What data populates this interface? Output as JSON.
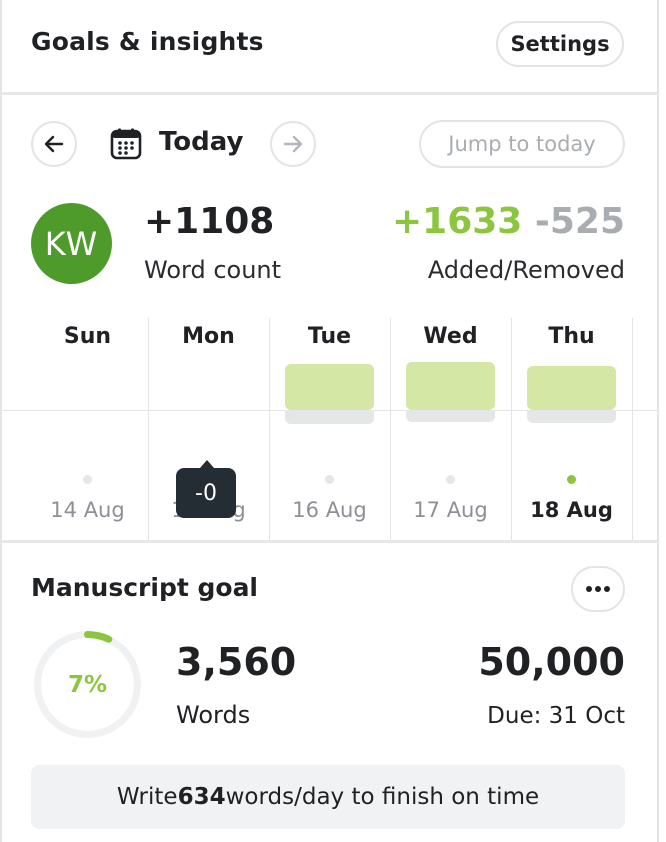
{
  "header": {
    "title": "Goals & insights",
    "settings_label": "Settings"
  },
  "date_nav": {
    "label": "Today",
    "jump_label": "Jump to today"
  },
  "stats": {
    "avatar_initials": "KW",
    "word_count_value": "+1108",
    "word_count_label": "Word count",
    "added": "+1633",
    "removed": "-525",
    "added_removed_label": "Added/Removed"
  },
  "week": {
    "days": [
      {
        "name": "Sun",
        "date": "14 Aug",
        "added": 0,
        "removed": 0,
        "today": false
      },
      {
        "name": "Mon",
        "date": "15 Aug",
        "added": 0,
        "removed": 0,
        "today": false
      },
      {
        "name": "Tue",
        "date": "16 Aug",
        "added": 1,
        "removed": 0.3,
        "today": false
      },
      {
        "name": "Wed",
        "date": "17 Aug",
        "added": 1.05,
        "removed": 0.25,
        "today": false
      },
      {
        "name": "Thu",
        "date": "18 Aug",
        "added": 0.95,
        "removed": 0.28,
        "today": true
      }
    ],
    "tooltip": "-0"
  },
  "manuscript": {
    "title": "Manuscript goal",
    "progress_percent": 7,
    "percent_label": "7%",
    "words_value": "3,560",
    "words_label": "Words",
    "goal_value": "50,000",
    "due_label": "Due: 31 Oct",
    "banner_prefix": "Write ",
    "banner_bold": "634",
    "banner_suffix": " words/day to finish on time"
  },
  "colors": {
    "accent": "#8cc63f",
    "avatar": "#4e9a2a",
    "bar_added": "#d5e7a4",
    "bar_removed": "#e5e6e8"
  }
}
